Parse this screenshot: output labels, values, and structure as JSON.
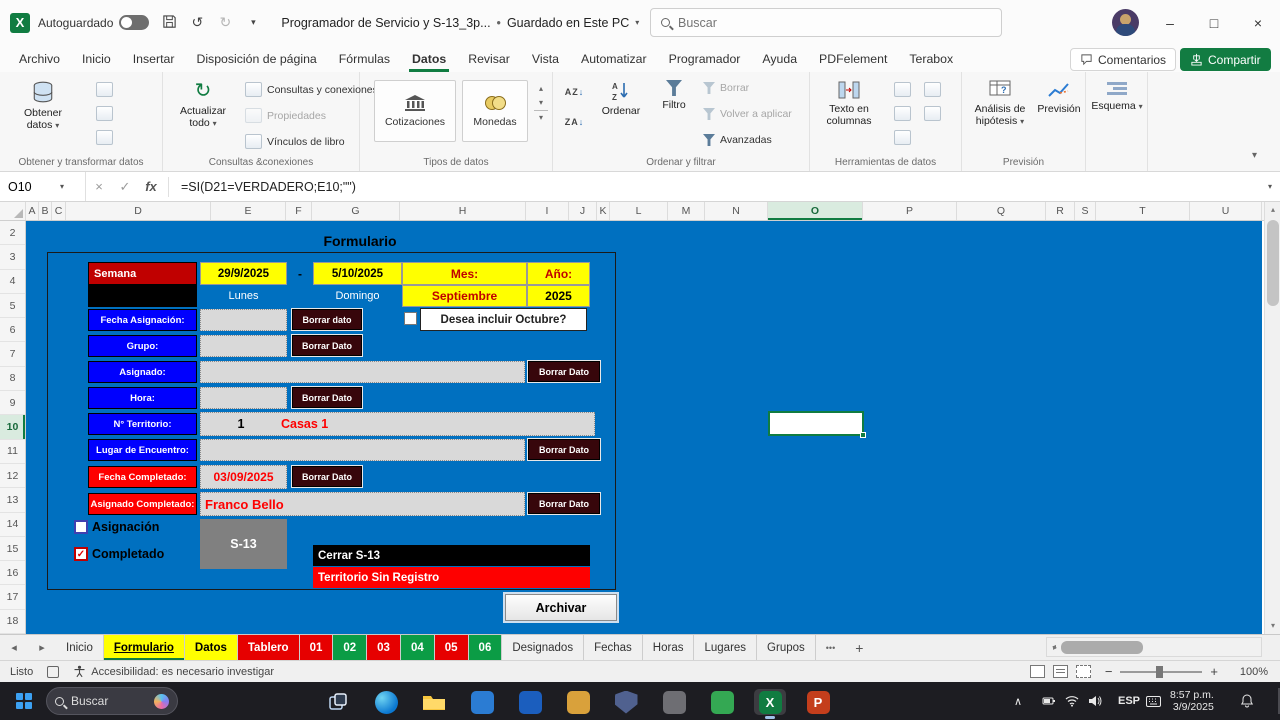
{
  "colors": {
    "excel_green": "#107C41",
    "canvas_blue": "#0070C0",
    "field_label_blue": "#0000FE",
    "alert_red": "#FE0000",
    "highlight_yellow": "#FFFF00",
    "borrar_maroon": "#37060B"
  },
  "glyphs": {
    "excel": "X",
    "powerpoint": "P",
    "undo": "↺",
    "redo": "↻",
    "refresh": "↻",
    "dropdown": "▾",
    "up": "▴",
    "down": "▾",
    "left": "◂",
    "right": "▸",
    "arrow_down": "↓",
    "letter_a": "A",
    "letter_z": "Z",
    "question": "?",
    "close": "×",
    "check": "✓",
    "minimize": "–",
    "maximize": "□",
    "more_tabs": "•••",
    "add_sheet": "+",
    "zoom_out": "−",
    "zoom_in": "+",
    "chevron_up": "∧",
    "dot": "•"
  },
  "titlebar": {
    "autosave_label": "Autoguardado",
    "doc_title": "Programador de Servicio y S-13_3p...",
    "saved_status": "Guardado en Este PC",
    "search_placeholder": "Buscar"
  },
  "menu": {
    "tabs": [
      "Archivo",
      "Inicio",
      "Insertar",
      "Disposición de página",
      "Fórmulas",
      "Datos",
      "Revisar",
      "Vista",
      "Automatizar",
      "Programador",
      "Ayuda",
      "PDFelement",
      "Terabox"
    ],
    "comments": "Comentarios",
    "share": "Compartir"
  },
  "ribbon": {
    "get_data": "Obtener datos",
    "refresh_all": "Actualizar todo",
    "queries_connections": "Consultas y conexiones",
    "properties": "Propiedades",
    "workbook_links": "Vínculos de libro",
    "stocks": "Cotizaciones",
    "currencies": "Monedas",
    "sort": "Ordenar",
    "filter": "Filtro",
    "clear": "Borrar",
    "reapply": "Volver a aplicar",
    "advanced": "Avanzadas",
    "text_to_columns": "Texto en columnas",
    "what_if": "Análisis de hipótesis",
    "forecast_sheet": "Previsión",
    "outline": "Esquema",
    "captions": {
      "get_transform": "Obtener y transformar datos",
      "connections": "Consultas &conexiones",
      "data_types": "Tipos de datos",
      "sort_filter": "Ordenar y filtrar",
      "data_tools": "Herramientas de datos",
      "forecast": "Previsión"
    }
  },
  "formula_bar": {
    "cell_ref": "O10",
    "fx": "fx",
    "formula": "=SI(D21=VERDADERO;E10;\"\")"
  },
  "grid": {
    "columns": [
      "A",
      "B",
      "C",
      "D",
      "E",
      "F",
      "G",
      "H",
      "I",
      "J",
      "K",
      "L",
      "M",
      "N",
      "O",
      "P",
      "Q",
      "R",
      "S",
      "T",
      "U"
    ],
    "rows": [
      "2",
      "3",
      "4",
      "5",
      "6",
      "7",
      "8",
      "9",
      "10",
      "11",
      "12",
      "13",
      "14",
      "15",
      "16",
      "17",
      "18"
    ],
    "selected_cell": "O10"
  },
  "form": {
    "title": "Formulario",
    "semana_label": "Semana",
    "week_start": "29/9/2025",
    "dash": "-",
    "week_end": "5/10/2025",
    "mes_label": "Mes:",
    "ano_label": "Año:",
    "day_start": "Lunes",
    "day_end": "Domingo",
    "month_value": "Septiembre",
    "year_value": "2025",
    "fecha_asignacion_label": "Fecha Asignación:",
    "borrar_dato_lower": "Borrar dato",
    "borrar_dato": "Borrar Dato",
    "octubre_question": "Desea incluir Octubre?",
    "grupo_label": "Grupo:",
    "asignado_label": "Asignado:",
    "hora_label": "Hora:",
    "territorio_label": "N° Territorio:",
    "territorio_num": "1",
    "territorio_tipo": "Casas 1",
    "lugar_label": "Lugar de Encuentro:",
    "fecha_completado_label": "Fecha Completado:",
    "fecha_completado_value": "03/09/2025",
    "asignado_completado_label": "Asignado Completado:",
    "asignado_completado_value": "Franco Bello",
    "asignacion_check_label": "Asignación",
    "completado_check_label": "Completado",
    "s13": "S-13",
    "cerrar_s13": "Cerrar S-13",
    "territorio_sin_registro": "Territorio Sin Registro",
    "archivar": "Archivar"
  },
  "sheet_bar": {
    "tabs": [
      {
        "label": "Inicio",
        "style": "plain"
      },
      {
        "label": "Formulario",
        "style": "yellow",
        "active": true
      },
      {
        "label": "Datos",
        "style": "yellow"
      },
      {
        "label": "Tablero",
        "style": "red"
      },
      {
        "label": "01",
        "style": "red"
      },
      {
        "label": "02",
        "style": "green"
      },
      {
        "label": "03",
        "style": "red"
      },
      {
        "label": "04",
        "style": "green"
      },
      {
        "label": "05",
        "style": "red"
      },
      {
        "label": "06",
        "style": "green"
      },
      {
        "label": "Designados",
        "style": "plain"
      },
      {
        "label": "Fechas",
        "style": "plain"
      },
      {
        "label": "Horas",
        "style": "plain"
      },
      {
        "label": "Lugares",
        "style": "plain"
      },
      {
        "label": "Grupos",
        "style": "plain"
      }
    ]
  },
  "status_bar": {
    "mode": "Listo",
    "accessibility": "Accesibilidad: es necesario investigar",
    "zoom": "100%"
  },
  "taskbar": {
    "search_placeholder": "Buscar",
    "lang": "ESP",
    "time": "8:57 p.m.",
    "date": "3/9/2025"
  }
}
